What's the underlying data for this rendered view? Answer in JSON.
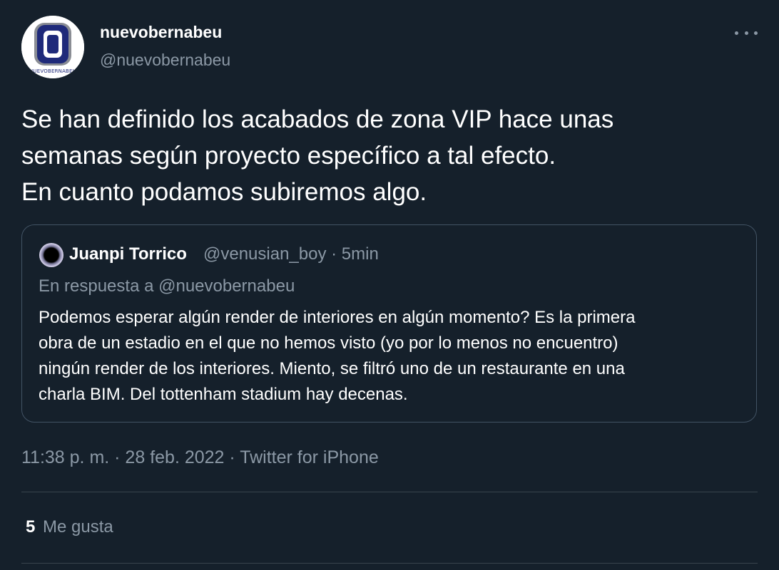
{
  "author": {
    "display_name": "nuevobernabeu",
    "handle": "@nuevobernabeu",
    "avatar_text": "NUEVOBERNABEU"
  },
  "tweet": {
    "text": "Se han definido los acabados de zona VIP hace unas\nsemanas según proyecto específico a tal efecto.\nEn cuanto podamos subiremos algo.",
    "timestamp": "11:38 p. m. · 28 feb. 2022 · ",
    "source": "Twitter for iPhone"
  },
  "quote": {
    "display_name": "Juanpi Torrico",
    "meta": "@venusian_boy · 5min",
    "reply_context": "En respuesta a @nuevobernabeu",
    "text": "Podemos esperar algún render de interiores en algún momento? Es la primera\nobra de un estadio en el que no hemos visto (yo por lo menos no encuentro)\nningún render de los interiores. Miento, se filtró uno de un restaurante en una\ncharla BIM. Del tottenham stadium hay decenas."
  },
  "stats": {
    "likes_count": "5",
    "likes_label": "Me gusta"
  },
  "icons": {
    "more": "more-horizontal-icon"
  },
  "colors": {
    "background": "#15202b",
    "secondary_text": "#8b98a5",
    "border": "#425364"
  }
}
